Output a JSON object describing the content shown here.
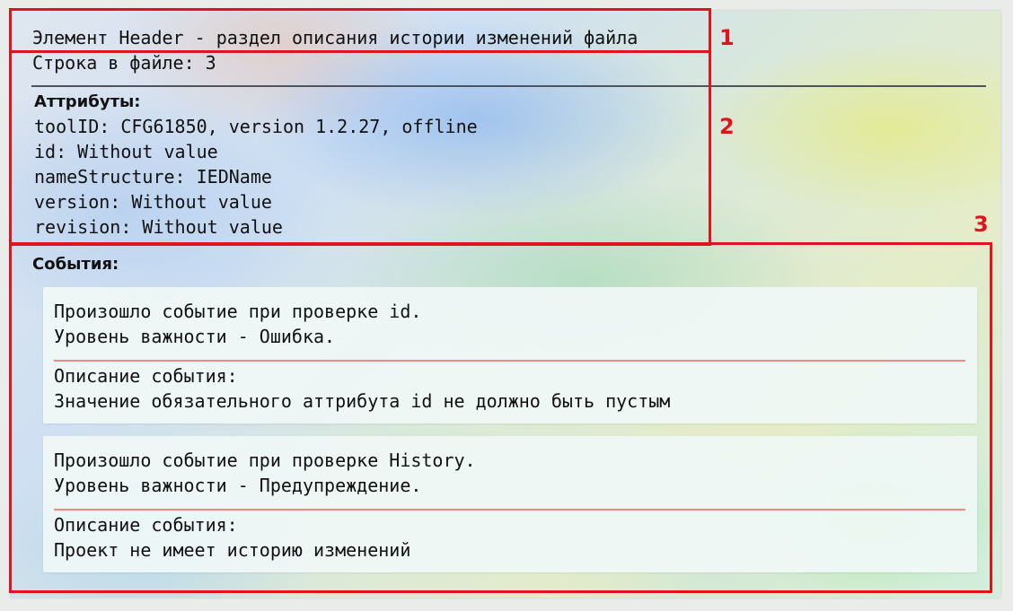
{
  "header": {
    "title": "Элемент Header - раздел описания истории изменений файла",
    "file_line": "Строка в файле: 3"
  },
  "attributes": {
    "heading": "Аттрибуты:",
    "items": [
      "toolID: CFG61850, version 1.2.27, offline",
      "id: Without value",
      "nameStructure: IEDName",
      "version: Without value",
      "revision: Without value"
    ]
  },
  "events": {
    "heading": "События:",
    "items": [
      {
        "line1": "Произошло событие при проверке id.",
        "line2": "Уровень важности - Ошибка.",
        "desc_label": "Описание события:",
        "desc_text": "Значение обязательного аттрибута id не должно быть пустым"
      },
      {
        "line1": "Произошло событие при проверке History.",
        "line2": "Уровень важности - Предупреждение.",
        "desc_label": "Описание события:",
        "desc_text": "Проект не имеет историю изменений"
      }
    ]
  },
  "annotations": {
    "box1_number": "1",
    "box2_number": "2",
    "box3_number": "3",
    "color": "#e0141f"
  },
  "colors": {
    "event_separator": "#f08a80",
    "header_divider": "#50545c"
  }
}
